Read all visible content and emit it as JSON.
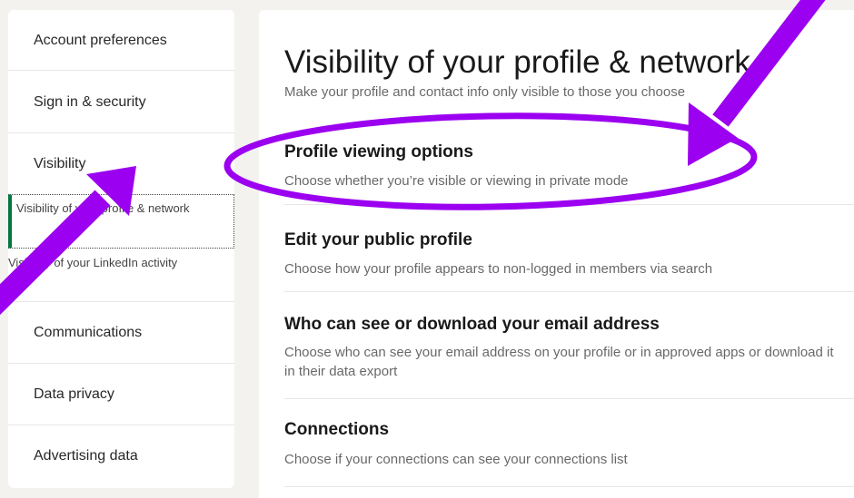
{
  "sidebar": {
    "items": {
      "account": "Account preferences",
      "signin": "Sign in & security",
      "visibility": "Visibility",
      "communications": "Communications",
      "data_privacy": "Data privacy",
      "advertising": "Advertising data"
    },
    "sub_items": {
      "profile_network": "Visibility of your profile & network",
      "linkedin_activity": "Visibility of your LinkedIn activity"
    }
  },
  "main": {
    "title": "Visibility of your profile & network",
    "subtitle": "Make your profile and contact info only visible to those you choose",
    "sections": [
      {
        "title": "Profile viewing options",
        "description": "Choose whether you’re visible or viewing in private mode"
      },
      {
        "title": "Edit your public profile",
        "description": "Choose how your profile appears to non-logged in members via search"
      },
      {
        "title": "Who can see or download your email address",
        "description": "Choose who can see your email address on your profile or in approved apps or download it in their data export"
      },
      {
        "title": "Connections",
        "description": "Choose if your connections can see your connections list"
      }
    ]
  },
  "colors": {
    "annotation": "#9b00f0",
    "active_indicator": "#057642",
    "page_background": "#f3f2ef"
  }
}
